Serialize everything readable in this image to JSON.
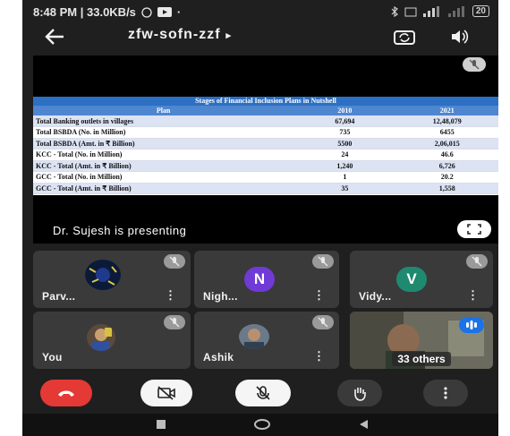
{
  "status_bar": {
    "time_speed": "8:48 PM | 33.0KB/s",
    "battery": "20"
  },
  "top_bar": {
    "back_icon": "arrow-left-icon",
    "meeting_code": "zfw-sofn-zzf",
    "caret": "▸",
    "switch_camera_icon": "camera-switch-icon",
    "speaker_icon": "speaker-icon"
  },
  "presentation": {
    "slide_title": "Stages of Financial Inclusion Plans in Nutshell",
    "headers": [
      "Plan",
      "2010",
      "2021"
    ],
    "rows": [
      [
        "Total Banking outlets in villages",
        "67,694",
        "12,48,079"
      ],
      [
        "Total BSBDA (No. in Million)",
        "735",
        "6455"
      ],
      [
        "Total BSBDA (Amt. in ₹ Billion)",
        "5500",
        "2,06,015"
      ],
      [
        "KCC - Total (No. in Million)",
        "24",
        "46.6"
      ],
      [
        "KCC - Total (Amt. in ₹ Billion)",
        "1,240",
        "6,726"
      ],
      [
        "GCC - Total (No. in Million)",
        "1",
        "20.2"
      ],
      [
        "GCC - Total (Amt. in ₹ Billion)",
        "35",
        "1,558"
      ]
    ],
    "presenting_text": "Dr. Sujesh is presenting",
    "fullscreen_icon": "fullscreen-icon"
  },
  "participants": [
    {
      "name": "Parv...",
      "avatar": "photo",
      "more": "⋮"
    },
    {
      "name": "Nigh...",
      "avatar": "N",
      "avatar_color": "#6f3ad6",
      "more": "⋮"
    },
    {
      "name": "Vidy...",
      "avatar": "V",
      "avatar_color": "#1f8a70",
      "more": "⋮"
    },
    {
      "name": "You",
      "avatar": "photo",
      "more": ""
    },
    {
      "name": "Ashik",
      "avatar": "photo",
      "more": "⋮"
    },
    {
      "name": "33 others",
      "avatar": "video",
      "more": ""
    }
  ],
  "controls": {
    "end_call_color": "#e53935",
    "end_call_icon": "phone-hangup-icon",
    "camera_icon": "camera-off-icon",
    "mic_icon": "mic-off-icon",
    "raise_hand_icon": "hand-icon",
    "more_icon": "more-vertical-icon"
  },
  "nav_bar": {
    "recents_icon": "square-icon",
    "home_icon": "circle-icon",
    "back_icon": "triangle-back-icon"
  }
}
